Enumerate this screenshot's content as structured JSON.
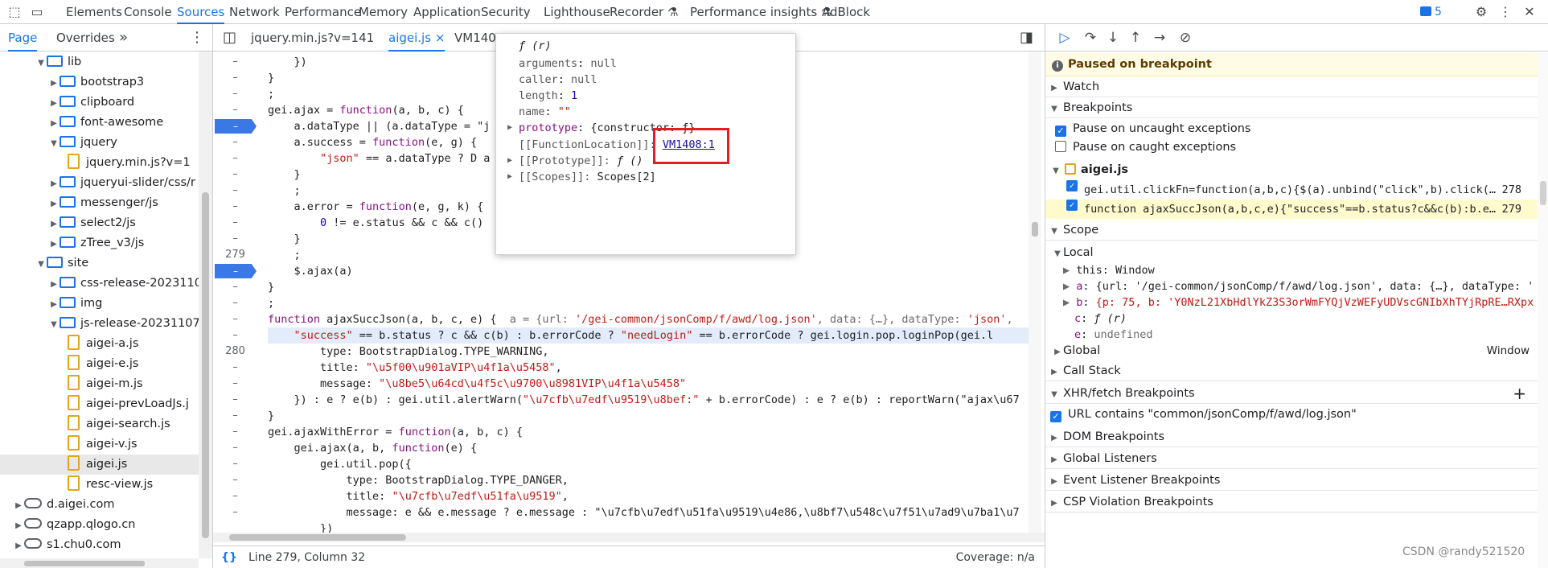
{
  "topbar": {
    "tabs": [
      "Elements",
      "Console",
      "Sources",
      "Network",
      "Performance",
      "Memory",
      "Application",
      "Security",
      "Lighthouse",
      "Recorder",
      "Performance insights",
      "AdBlock"
    ],
    "active": "Sources",
    "issues_count": "5"
  },
  "navigator": {
    "tabs": [
      "Page",
      "Overrides"
    ],
    "active": "Page",
    "more": "»",
    "tree": [
      {
        "label": "lib",
        "type": "folder",
        "open": true
      },
      {
        "label": "bootstrap3",
        "type": "folder",
        "open": false
      },
      {
        "label": "clipboard",
        "type": "folder",
        "open": false
      },
      {
        "label": "font-awesome",
        "type": "folder",
        "open": false
      },
      {
        "label": "jquery",
        "type": "folder",
        "open": true
      },
      {
        "label": "jquery.min.js?v=1",
        "type": "file"
      },
      {
        "label": "jqueryui-slider/css/r",
        "type": "folder",
        "open": false
      },
      {
        "label": "messenger/js",
        "type": "folder",
        "open": false
      },
      {
        "label": "select2/js",
        "type": "folder",
        "open": false
      },
      {
        "label": "zTree_v3/js",
        "type": "folder",
        "open": false
      },
      {
        "label": "site",
        "type": "folder",
        "open": true
      },
      {
        "label": "css-release-2023110",
        "type": "folder",
        "open": false
      },
      {
        "label": "img",
        "type": "folder",
        "open": false
      },
      {
        "label": "js-release-20231107",
        "type": "folder",
        "open": true
      },
      {
        "label": "aigei-a.js",
        "type": "file"
      },
      {
        "label": "aigei-e.js",
        "type": "file"
      },
      {
        "label": "aigei-m.js",
        "type": "file"
      },
      {
        "label": "aigei-prevLoadJs.j",
        "type": "file"
      },
      {
        "label": "aigei-search.js",
        "type": "file"
      },
      {
        "label": "aigei-v.js",
        "type": "file"
      },
      {
        "label": "aigei.js",
        "type": "file",
        "selected": true
      },
      {
        "label": "resc-view.js",
        "type": "file"
      },
      {
        "label": "d.aigei.com",
        "type": "domain"
      },
      {
        "label": "qzapp.qlogo.cn",
        "type": "domain"
      },
      {
        "label": "s1.chu0.com",
        "type": "domain"
      }
    ]
  },
  "editor": {
    "tabs": [
      "jquery.min.js?v=141",
      "aigei.js",
      "VM1408"
    ],
    "active": "aigei.js",
    "close_symbol": "×",
    "gutter": [
      {
        "text": "–"
      },
      {
        "text": "–"
      },
      {
        "text": "–"
      },
      {
        "text": "–"
      },
      {
        "text": "–",
        "bp": true
      },
      {
        "text": "–"
      },
      {
        "text": "–"
      },
      {
        "text": "–"
      },
      {
        "text": "–"
      },
      {
        "text": "–"
      },
      {
        "text": "–"
      },
      {
        "text": "–"
      },
      {
        "text": "279"
      },
      {
        "text": "–",
        "bp": true
      },
      {
        "text": "–"
      },
      {
        "text": "–"
      },
      {
        "text": "–"
      },
      {
        "text": "–"
      },
      {
        "text": "280"
      },
      {
        "text": "–"
      },
      {
        "text": "–"
      },
      {
        "text": "–"
      },
      {
        "text": "–"
      },
      {
        "text": "–"
      },
      {
        "text": "–"
      },
      {
        "text": "–"
      },
      {
        "text": "–"
      },
      {
        "text": "–"
      },
      {
        "text": "–"
      }
    ],
    "code": [
      "    })",
      "}",
      ";",
      "gei.ajax = function(a, b, c) {",
      "    a.dataType || (a.dataType = \"j",
      "    a.success = function(e, g) {",
      "        \"json\" == a.dataType ? D a",
      "    }",
      "    ;",
      "    a.error = function(e, g, k) {",
      "        0 != e.status && c && c()",
      "    }",
      "    ;",
      "    $.ajax(a)",
      "}",
      ";",
      "function ajaxSuccJson(a, b, c, e) {  a = {url: '/gei-common/jsonComp/f/awd/log.json', data: {…}, dataType: 'json', ",
      "    \"success\" == b.status ? c && c(b) : b.errorCode ? \"needLogin\" == b.errorCode ? gei.login.pop.loginPop(gei.l",
      "        type: BootstrapDialog.TYPE_WARNING,",
      "        title: \"\\u5f00\\u901aVIP\\u4f1a\\u5458\",",
      "        message: \"\\u8be5\\u64cd\\u4f5c\\u9700\\u8981VIP\\u4f1a\\u5458\"",
      "    }) : e ? e(b) : gei.util.alertWarn(\"\\u7cfb\\u7edf\\u9519\\u8bef:\" + b.errorCode) : e ? e(b) : reportWarn(\"ajax\\u67",
      "}",
      "gei.ajaxWithError = function(a, b, c) {",
      "    gei.ajax(a, b, function(e) {",
      "        gei.util.pop({",
      "            type: BootstrapDialog.TYPE_DANGER,",
      "            title: \"\\u7cfb\\u7edf\\u51fa\\u9519\",",
      "            message: e && e.message ? e.message : \"\\u7cfb\\u7edf\\u51fa\\u9519\\u4e86,\\u8bf7\\u548c\\u7f51\\u7ad9\\u7ba1\\u7",
      "        })",
      "    })",
      "}",
      ";"
    ],
    "status": {
      "position": "Line 279, Column 32",
      "coverage": "Coverage: n/a"
    }
  },
  "popover": {
    "header": "ƒ (r)",
    "props": [
      {
        "k": "arguments",
        "v": "null"
      },
      {
        "k": "caller",
        "v": "null"
      },
      {
        "k": "length",
        "v": "1"
      },
      {
        "k": "name",
        "v": "\"\""
      }
    ],
    "prototype_label": "prototype",
    "prototype_value": "{constructor: ƒ}",
    "function_location_label": "[[FunctionLocation]]:",
    "function_location_link": "VM1408:1",
    "proto_label": "[[Prototype]]:",
    "proto_value": "ƒ ()",
    "scopes_label": "[[Scopes]]:",
    "scopes_value": "Scopes[2]"
  },
  "debugger": {
    "paused": "Paused on breakpoint",
    "sections": {
      "watch": "Watch",
      "breakpoints": "Breakpoints",
      "scope": "Scope",
      "call_stack": "Call Stack",
      "xhr": "XHR/fetch Breakpoints",
      "dom": "DOM Breakpoints",
      "global_listeners": "Global Listeners",
      "event_listener": "Event Listener Breakpoints",
      "csp": "CSP Violation Breakpoints"
    },
    "pause_uncaught": "Pause on uncaught exceptions",
    "pause_caught": "Pause on caught exceptions",
    "bp_file": "aigei.js",
    "bp_items": [
      {
        "code": "gei.util.clickFn=function(a,b,c){$(a).unbind(\"click\",b).click(…",
        "line": "278"
      },
      {
        "code": "function ajaxSuccJson(a,b,c,e){\"success\"==b.status?c&&c(b):b.e…",
        "line": "279"
      }
    ],
    "scope_local": "Local",
    "scope_items": [
      {
        "k": "this",
        "v": "Window"
      },
      {
        "k": "a",
        "v": "{url: '/gei-common/jsonComp/f/awd/log.json', data: {…}, dataType: 'j"
      },
      {
        "k": "b",
        "v": "{p: 75, b: 'Y0NzL21XbHdlYkZ3S3orWmFYQjVzWEFyUDVscGNIbXhTYjRpRE…RXpxZ"
      },
      {
        "k": "c",
        "v": "ƒ (r)"
      },
      {
        "k": "e",
        "v": "undefined"
      }
    ],
    "scope_global": "Global",
    "scope_global_value": "Window",
    "xhr_item": "URL contains \"common/jsonComp/f/awd/log.json\"",
    "plus": "+"
  },
  "watermark": "CSDN @randy521520"
}
